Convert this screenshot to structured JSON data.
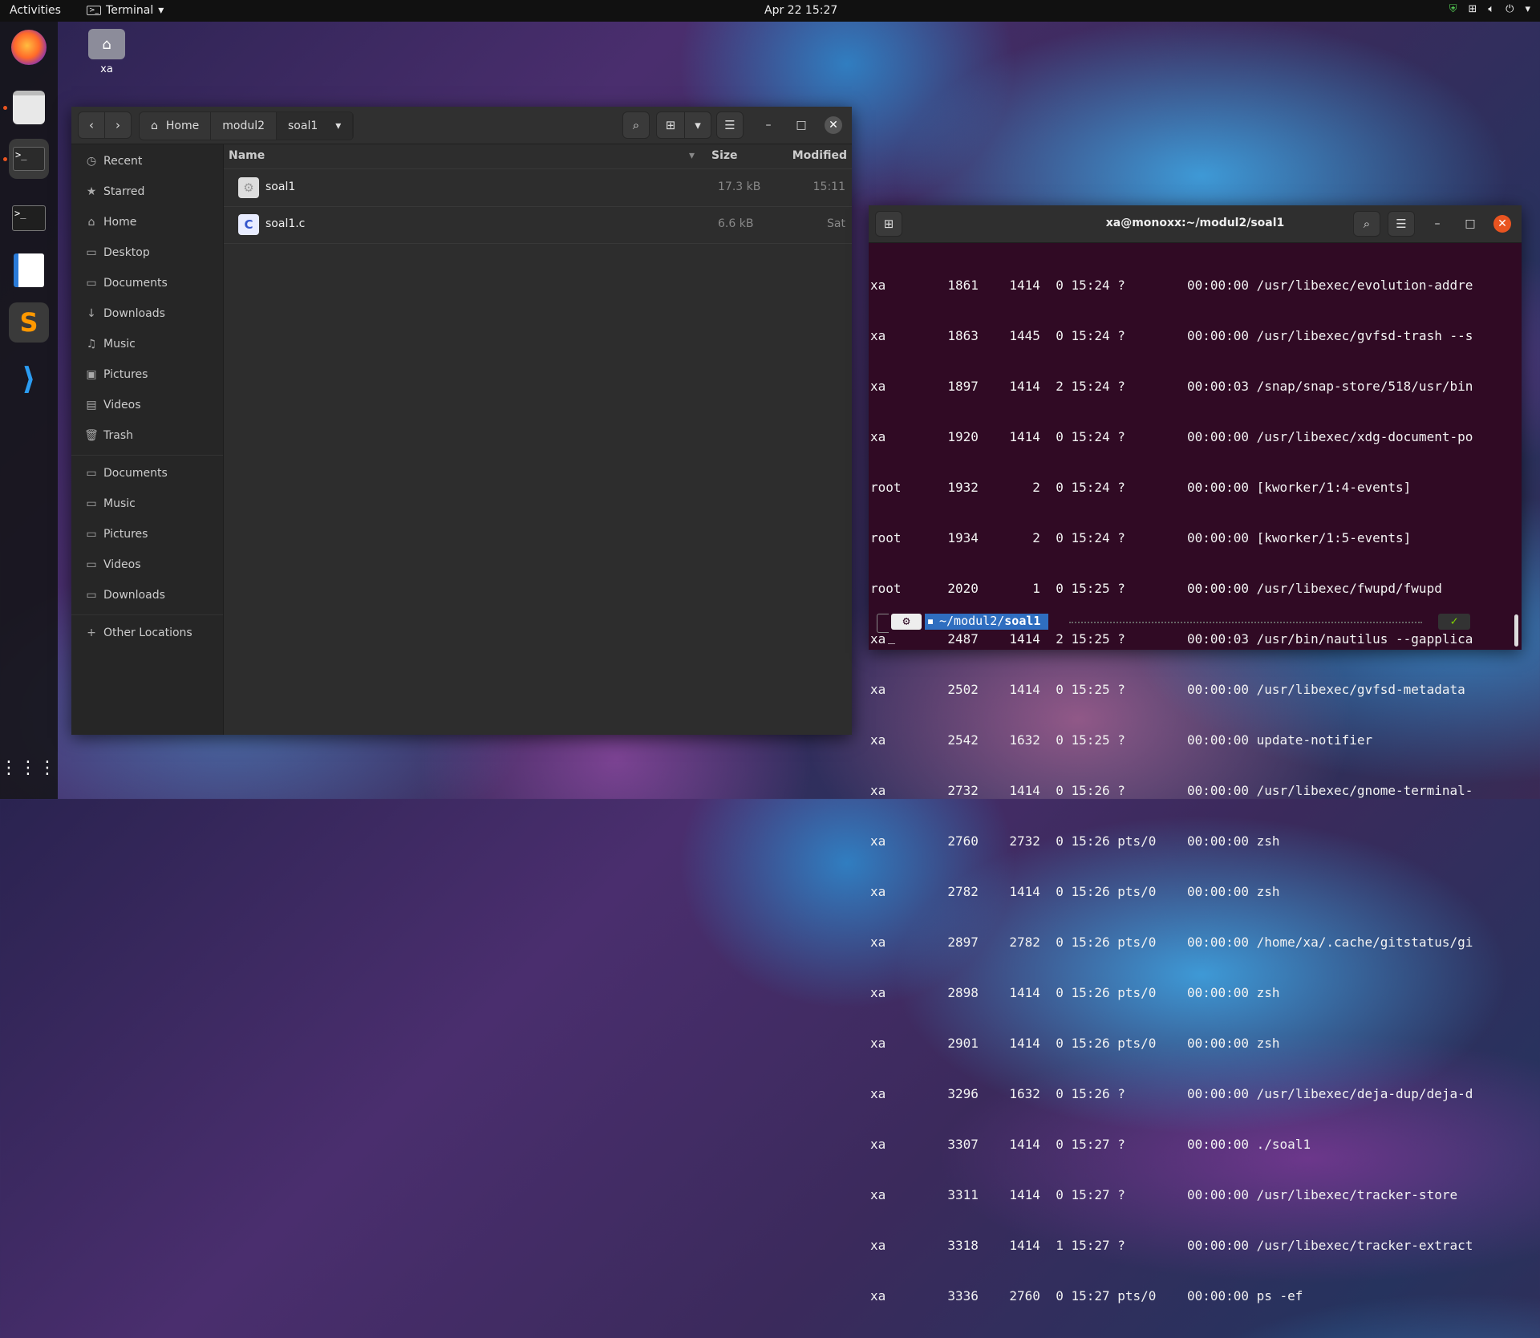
{
  "topbar": {
    "activities": "Activities",
    "app_name": "Terminal",
    "clock": "Apr 22  15:27"
  },
  "desktop": {
    "home_icon_label": "xa"
  },
  "files": {
    "breadcrumbs": [
      "Home",
      "modul2",
      "soal1"
    ],
    "sidebar_places": [
      {
        "icon": "clock-icon",
        "label": "Recent"
      },
      {
        "icon": "star-icon",
        "label": "Starred"
      },
      {
        "icon": "home-icon",
        "label": "Home"
      },
      {
        "icon": "folder-icon",
        "label": "Desktop"
      },
      {
        "icon": "folder-icon",
        "label": "Documents"
      },
      {
        "icon": "download-icon",
        "label": "Downloads"
      },
      {
        "icon": "music-icon",
        "label": "Music"
      },
      {
        "icon": "pictures-icon",
        "label": "Pictures"
      },
      {
        "icon": "video-icon",
        "label": "Videos"
      },
      {
        "icon": "trash-icon",
        "label": "Trash"
      }
    ],
    "sidebar_bookmarks": [
      {
        "icon": "folder-icon",
        "label": "Documents"
      },
      {
        "icon": "folder-icon",
        "label": "Music"
      },
      {
        "icon": "folder-icon",
        "label": "Pictures"
      },
      {
        "icon": "folder-icon",
        "label": "Videos"
      },
      {
        "icon": "folder-icon",
        "label": "Downloads"
      }
    ],
    "other_locations": "Other Locations",
    "columns": {
      "name": "Name",
      "size": "Size",
      "modified": "Modified"
    },
    "rows": [
      {
        "icon": "executable-icon",
        "name": "soal1",
        "size": "17.3 kB",
        "modified": "15:11"
      },
      {
        "icon": "c-source-icon",
        "name": "soal1.c",
        "size": "6.6 kB",
        "modified": "Sat"
      }
    ]
  },
  "terminal": {
    "title": "xa@monoxx:~/modul2/soal1",
    "lines": [
      "xa        1861    1414  0 15:24 ?        00:00:00 /usr/libexec/evolution-addre",
      "xa        1863    1445  0 15:24 ?        00:00:00 /usr/libexec/gvfsd-trash --s",
      "xa        1897    1414  2 15:24 ?        00:00:03 /snap/snap-store/518/usr/bin",
      "xa        1920    1414  0 15:24 ?        00:00:00 /usr/libexec/xdg-document-po",
      "root      1932       2  0 15:24 ?        00:00:00 [kworker/1:4-events]",
      "root      1934       2  0 15:24 ?        00:00:00 [kworker/1:5-events]",
      "root      2020       1  0 15:25 ?        00:00:00 /usr/libexec/fwupd/fwupd",
      "xa        2487    1414  2 15:25 ?        00:00:03 /usr/bin/nautilus --gapplica",
      "xa        2502    1414  0 15:25 ?        00:00:00 /usr/libexec/gvfsd-metadata",
      "xa        2542    1632  0 15:25 ?        00:00:00 update-notifier",
      "xa        2732    1414  0 15:26 ?        00:00:00 /usr/libexec/gnome-terminal-",
      "xa        2760    2732  0 15:26 pts/0    00:00:00 zsh",
      "xa        2782    1414  0 15:26 pts/0    00:00:00 zsh",
      "xa        2897    2782  0 15:26 pts/0    00:00:00 /home/xa/.cache/gitstatus/gi",
      "xa        2898    1414  0 15:26 pts/0    00:00:00 zsh",
      "xa        2901    1414  0 15:26 pts/0    00:00:00 zsh",
      "xa        3296    1632  0 15:26 ?        00:00:00 /usr/libexec/deja-dup/deja-d",
      "xa        3307    1414  0 15:27 ?        00:00:00 ./soal1",
      "xa        3311    1414  0 15:27 ?        00:00:00 /usr/libexec/tracker-store",
      "xa        3318    1414  1 15:27 ?        00:00:00 /usr/libexec/tracker-extract",
      "xa        3336    2760  0 15:27 pts/0    00:00:00 ps -ef"
    ],
    "prompt_path": "~/modul2/",
    "prompt_dir": "soal1",
    "prompt_status": "✓",
    "cursor": "_"
  },
  "colors": {
    "terminal_bg": "#300a24",
    "prompt_path_bg": "#2f6ec0",
    "status_ok": "#7fd000",
    "accent": "#e95420"
  }
}
